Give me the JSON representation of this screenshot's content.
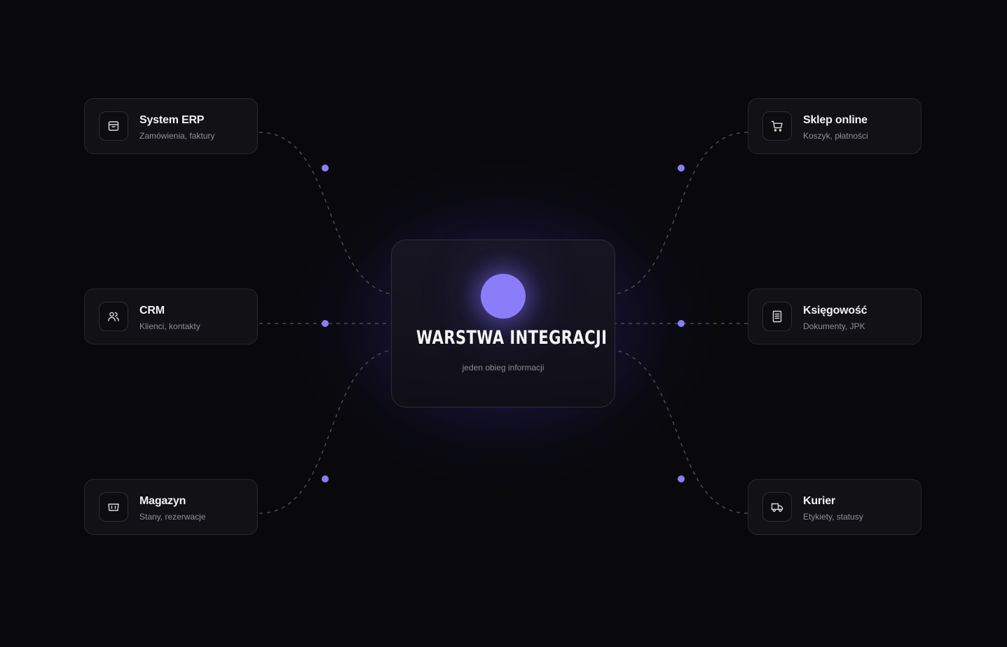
{
  "colors": {
    "background": "#09090b",
    "card": "#121216",
    "card_border": "#26262c",
    "accent": "#8b7cf8",
    "connector": "#4a4a52",
    "text_primary": "#f2f2f5",
    "text_secondary": "#8e8e99"
  },
  "hub": {
    "title": "WARSTWA INTEGRACJI",
    "subtitle": "jeden obieg informacji"
  },
  "nodes": {
    "erp": {
      "title": "System ERP",
      "subtitle": "Zamówienia, faktury",
      "icon": "archive-box-icon"
    },
    "crm": {
      "title": "CRM",
      "subtitle": "Klienci, kontakty",
      "icon": "users-icon"
    },
    "magazyn": {
      "title": "Magazyn",
      "subtitle": "Stany, rezerwacje",
      "icon": "warehouse-icon"
    },
    "sklep": {
      "title": "Sklep online",
      "subtitle": "Koszyk, płatności",
      "icon": "shopping-cart-icon"
    },
    "ksiegowosc": {
      "title": "Księgowość",
      "subtitle": "Dokumenty, JPK",
      "icon": "document-icon"
    },
    "kurier": {
      "title": "Kurier",
      "subtitle": "Etykiety, statusy",
      "icon": "delivery-truck-icon"
    }
  }
}
